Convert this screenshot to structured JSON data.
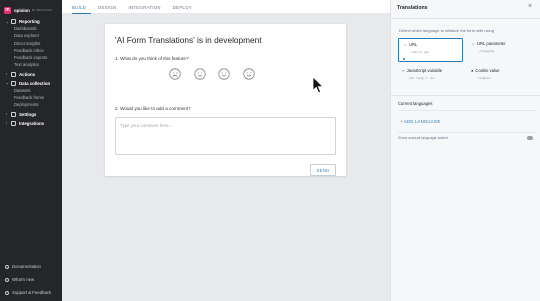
{
  "brand": {
    "logo_letter": "m",
    "name": "opinion",
    "sub": "BY MOTIVACA"
  },
  "sidebar": {
    "sections": [
      {
        "label": "Reporting",
        "items": [
          "Dashboards",
          "Data explorer",
          "Direct insights",
          "Feedback inbox",
          "Feedback exports",
          "Text analytics"
        ]
      },
      {
        "label": "Actions",
        "items": []
      },
      {
        "label": "Data collection",
        "items": [
          "Datasets",
          "Feedback forms",
          "Deployments"
        ]
      },
      {
        "label": "Settings",
        "items": []
      },
      {
        "label": "Integrations",
        "items": []
      }
    ],
    "footer": [
      "Documentation",
      "What's new",
      "Support & Feedback"
    ]
  },
  "tabs": [
    {
      "label": "BUILD",
      "active": true
    },
    {
      "label": "DESIGN",
      "active": false
    },
    {
      "label": "INTEGRATION",
      "active": false
    },
    {
      "label": "DEPLOY",
      "active": false
    }
  ],
  "form": {
    "title": "'AI Form Translations' is in development",
    "q1": "1.  What do you think of this feature?",
    "q2": "2.  Would you like to add a comment?",
    "comment_placeholder": "Type your comment here...",
    "send_label": "SEND"
  },
  "panel": {
    "title": "Translations",
    "close": "×",
    "detect_text": "Detect which language to initialize the form with using",
    "options": [
      {
        "icon": "⇔",
        "label": "URL",
        "code": "…/en/ur_pb/",
        "selected": true
      },
      {
        "icon": "⇔",
        "label": "URL parameter",
        "code": "…?lang=en",
        "selected": false
      },
      {
        "icon": "‹›",
        "label": "JavaScript variable",
        "code": "var lang = 'en'",
        "selected": false
      },
      {
        "icon": "●",
        "label": "Cookie value",
        "code": "lang=en",
        "selected": false
      }
    ],
    "current_languages": "Current languages",
    "add_language": "+ ADD LANGUAGE",
    "show_manual": "Show manual language switch"
  },
  "colors": {
    "accent": "#2a7ab8",
    "sidebar_bg": "#25262a",
    "brand": "#e0306f"
  }
}
